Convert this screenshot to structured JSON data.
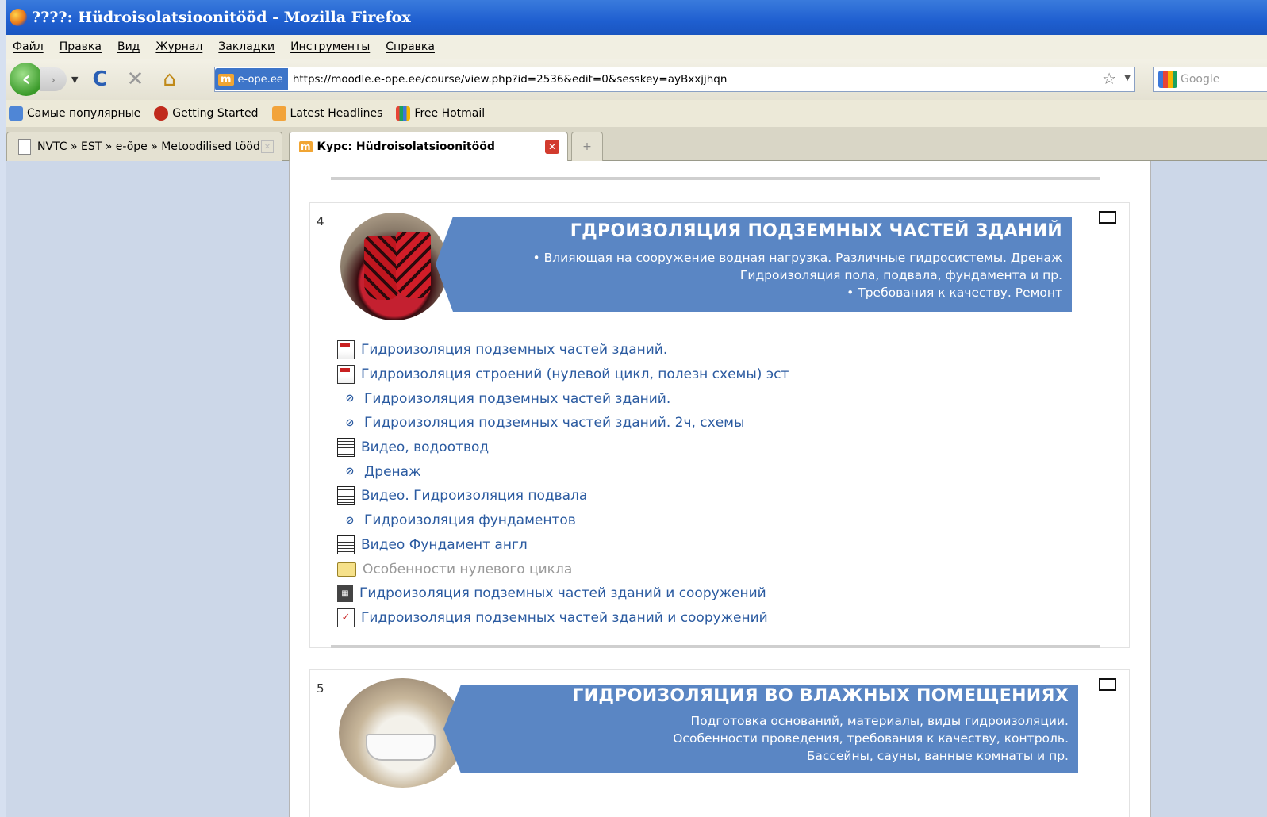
{
  "window": {
    "title": "????: Hüdroisolatsioonitööd - Mozilla Firefox"
  },
  "menu": [
    "Файл",
    "Правка",
    "Вид",
    "Журнал",
    "Закладки",
    "Инструменты",
    "Справка"
  ],
  "nav": {
    "site_identity": "e-ope.ee",
    "url": "https://moodle.e-ope.ee/course/view.php?id=2536&edit=0&sesskey=ayBxxjjhqn",
    "search_placeholder": "Google"
  },
  "bookmarks": [
    "Самые популярные",
    "Getting Started",
    "Latest Headlines",
    "Free Hotmail"
  ],
  "tabs": [
    {
      "label": "NVTC » EST » e-õpe » Metoodilised tööd"
    },
    {
      "label": "Курс: Hüdroisolatsioonitööd"
    }
  ],
  "colors": {
    "banner": "#5a86c4",
    "link": "#2a5aa0",
    "content_bg": "#ccd7e8"
  },
  "sections": [
    {
      "number": "4",
      "banner_title": "ГДРОИЗОЛЯЦИЯ ПОДЗЕМНЫХ ЧАСТЕЙ ЗДАНИЙ",
      "banner_lines": [
        "• Влияющая на сооружение водная нагрузка. Различные гидросистемы.  Дренаж",
        "Гидроизоляция пола, подвала, фундамента и пр.",
        "• Требования к качеству. Ремонт"
      ],
      "items": [
        {
          "icon": "pdf",
          "label": "Гидроизоляция подземных частей зданий."
        },
        {
          "icon": "pdf",
          "label": "Гидроизоляция строений (нулевой цикл, полезн схемы) эст"
        },
        {
          "icon": "url",
          "label": "Гидроизоляция подземных частей зданий."
        },
        {
          "icon": "url",
          "label": "Гидроизоляция подземных частей зданий. 2ч, схемы"
        },
        {
          "icon": "page",
          "label": "Видео, водоотвод"
        },
        {
          "icon": "url",
          "label": "Дренаж"
        },
        {
          "icon": "page",
          "label": "Видео. Гидроизоляция подвала"
        },
        {
          "icon": "url",
          "label": "Гидроизоляция фундаментов"
        },
        {
          "icon": "page",
          "label": "Видео Фундамент англ"
        },
        {
          "icon": "folder",
          "label": "Особенности нулевого цикла"
        },
        {
          "icon": "book",
          "label": "Гидроизоляция подземных частей зданий и сооружений"
        },
        {
          "icon": "quiz",
          "label": "Гидроизоляция подземных частей зданий и сооружений"
        }
      ]
    },
    {
      "number": "5",
      "banner_title": "ГИДРОИЗОЛЯЦИЯ ВО ВЛАЖНЫХ ПОМЕЩЕНИЯХ",
      "banner_lines": [
        "Подготовка оснований, материалы, виды гидроизоляции.",
        "Особенности проведения, требования к качеству, контроль.",
        "Бассейны, сауны, ванные комнаты и пр."
      ]
    }
  ]
}
